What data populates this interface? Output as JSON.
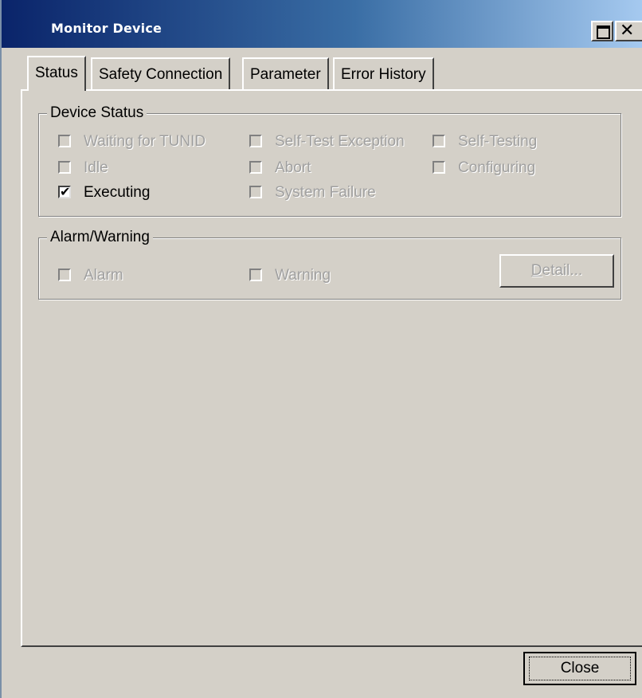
{
  "window": {
    "title": "Monitor Device",
    "maximize_icon": "maximize-icon",
    "close_icon": "close-icon"
  },
  "tabs": [
    {
      "label": "Status",
      "active": true
    },
    {
      "label": "Safety Connection",
      "active": false
    },
    {
      "label": "Parameter",
      "active": false
    },
    {
      "label": "Error History",
      "active": false
    }
  ],
  "device_status": {
    "legend": "Device Status",
    "items": [
      {
        "label": "Waiting for TUNID",
        "checked": false,
        "enabled": false
      },
      {
        "label": "Self-Test Exception",
        "checked": false,
        "enabled": false
      },
      {
        "label": "Self-Testing",
        "checked": false,
        "enabled": false
      },
      {
        "label": "Idle",
        "checked": false,
        "enabled": false
      },
      {
        "label": "Abort",
        "checked": false,
        "enabled": false
      },
      {
        "label": "Configuring",
        "checked": false,
        "enabled": false
      },
      {
        "label": "Executing",
        "checked": true,
        "enabled": true
      },
      {
        "label": "System Failure",
        "checked": false,
        "enabled": false
      }
    ]
  },
  "alarm_warning": {
    "legend": "Alarm/Warning",
    "alarm_label": "Alarm",
    "warning_label": "Warning",
    "detail_button_first": "D",
    "detail_button_rest": "etail..."
  },
  "footer": {
    "close_label": "Close"
  },
  "colors": {
    "face": "#d4d0c8",
    "title_start": "#0a246a",
    "title_end": "#a6caf0",
    "disabled_text": "#a0a0a0"
  }
}
